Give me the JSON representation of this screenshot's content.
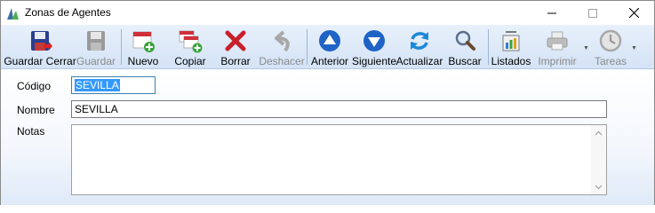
{
  "window": {
    "title": "Zonas de Agentes"
  },
  "toolbar": {
    "buttons": [
      {
        "label": "Guardar Cerrar",
        "icon": "save-close-icon",
        "enabled": true
      },
      {
        "label": "Guardar",
        "icon": "save-icon",
        "enabled": false
      },
      {
        "label": "Nuevo",
        "icon": "new-record-icon",
        "enabled": true
      },
      {
        "label": "Copiar",
        "icon": "copy-record-icon",
        "enabled": true
      },
      {
        "label": "Borrar",
        "icon": "delete-icon",
        "enabled": true
      },
      {
        "label": "Deshacer",
        "icon": "undo-icon",
        "enabled": false
      },
      {
        "label": "Anterior",
        "icon": "arrow-up-icon",
        "enabled": true
      },
      {
        "label": "Siguiente",
        "icon": "arrow-down-icon",
        "enabled": true
      },
      {
        "label": "Actualizar",
        "icon": "refresh-icon",
        "enabled": true
      },
      {
        "label": "Buscar",
        "icon": "search-icon",
        "enabled": true
      },
      {
        "label": "Listados",
        "icon": "reports-icon",
        "enabled": true
      },
      {
        "label": "Imprimir",
        "icon": "printer-icon",
        "enabled": false
      },
      {
        "label": "Tareas",
        "icon": "clock-icon",
        "enabled": false
      }
    ]
  },
  "form": {
    "codigo": {
      "label": "Código",
      "value": "SEVILLA"
    },
    "nombre": {
      "label": "Nombre",
      "value": "SEVILLA"
    },
    "notas": {
      "label": "Notas",
      "value": ""
    }
  },
  "colors": {
    "accent": "#3399ff",
    "toolbar_bg": "#dce8f8",
    "delete_red": "#c8202a",
    "nav_blue": "#1f63c6"
  }
}
